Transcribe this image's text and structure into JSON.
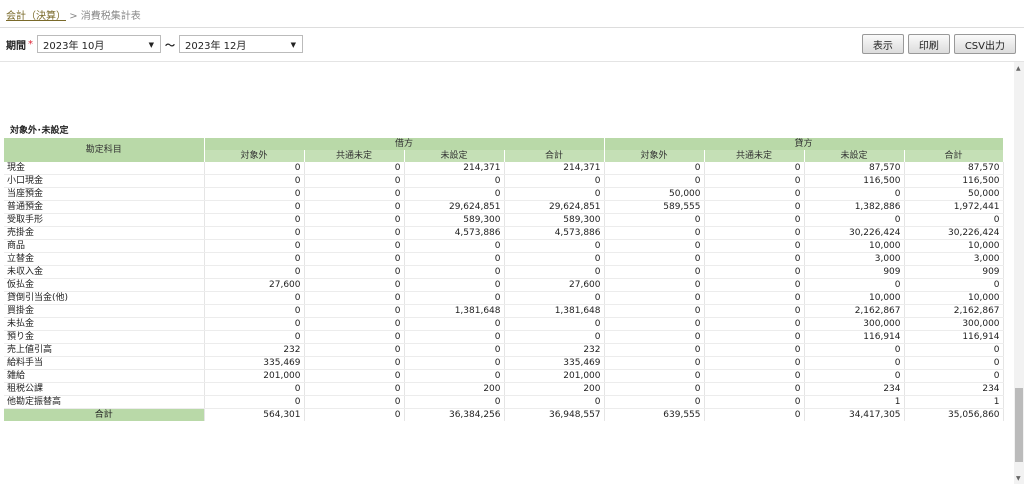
{
  "breadcrumb": {
    "parent": "会計（決算）",
    "sep": ">",
    "current": "消費税集計表"
  },
  "filter": {
    "label": "期間",
    "required": "*",
    "from": "2023年 10月",
    "tilde": "～",
    "to": "2023年 12月"
  },
  "buttons": {
    "show": "表示",
    "print": "印刷",
    "csv": "CSV出力"
  },
  "section_title": "対象外･未設定",
  "table": {
    "account_header": "勘定科目",
    "debit_header": "借方",
    "credit_header": "貸方",
    "sub_headers": [
      "対象外",
      "共通未定",
      "未設定",
      "合計"
    ],
    "rows": [
      [
        "現金",
        "0",
        "0",
        "214,371",
        "214,371",
        "0",
        "0",
        "87,570",
        "87,570"
      ],
      [
        "小口現金",
        "0",
        "0",
        "0",
        "0",
        "0",
        "0",
        "116,500",
        "116,500"
      ],
      [
        "当座預金",
        "0",
        "0",
        "0",
        "0",
        "50,000",
        "0",
        "0",
        "50,000"
      ],
      [
        "普通預金",
        "0",
        "0",
        "29,624,851",
        "29,624,851",
        "589,555",
        "0",
        "1,382,886",
        "1,972,441"
      ],
      [
        "受取手形",
        "0",
        "0",
        "589,300",
        "589,300",
        "0",
        "0",
        "0",
        "0"
      ],
      [
        "売掛金",
        "0",
        "0",
        "4,573,886",
        "4,573,886",
        "0",
        "0",
        "30,226,424",
        "30,226,424"
      ],
      [
        "商品",
        "0",
        "0",
        "0",
        "0",
        "0",
        "0",
        "10,000",
        "10,000"
      ],
      [
        "立替金",
        "0",
        "0",
        "0",
        "0",
        "0",
        "0",
        "3,000",
        "3,000"
      ],
      [
        "未収入金",
        "0",
        "0",
        "0",
        "0",
        "0",
        "0",
        "909",
        "909"
      ],
      [
        "仮払金",
        "27,600",
        "0",
        "0",
        "27,600",
        "0",
        "0",
        "0",
        "0"
      ],
      [
        "貸倒引当金(他)",
        "0",
        "0",
        "0",
        "0",
        "0",
        "0",
        "10,000",
        "10,000"
      ],
      [
        "買掛金",
        "0",
        "0",
        "1,381,648",
        "1,381,648",
        "0",
        "0",
        "2,162,867",
        "2,162,867"
      ],
      [
        "未払金",
        "0",
        "0",
        "0",
        "0",
        "0",
        "0",
        "300,000",
        "300,000"
      ],
      [
        "預り金",
        "0",
        "0",
        "0",
        "0",
        "0",
        "0",
        "116,914",
        "116,914"
      ],
      [
        "売上値引高",
        "232",
        "0",
        "0",
        "232",
        "0",
        "0",
        "0",
        "0"
      ],
      [
        "給料手当",
        "335,469",
        "0",
        "0",
        "335,469",
        "0",
        "0",
        "0",
        "0"
      ],
      [
        "雑給",
        "201,000",
        "0",
        "0",
        "201,000",
        "0",
        "0",
        "0",
        "0"
      ],
      [
        "租税公課",
        "0",
        "0",
        "200",
        "200",
        "0",
        "0",
        "234",
        "234"
      ],
      [
        "他勘定振替高",
        "0",
        "0",
        "0",
        "0",
        "0",
        "0",
        "1",
        "1"
      ]
    ],
    "total_label": "合計",
    "totals": [
      "564,301",
      "0",
      "36,384,256",
      "36,948,557",
      "639,555",
      "0",
      "34,417,305",
      "35,056,860"
    ]
  }
}
